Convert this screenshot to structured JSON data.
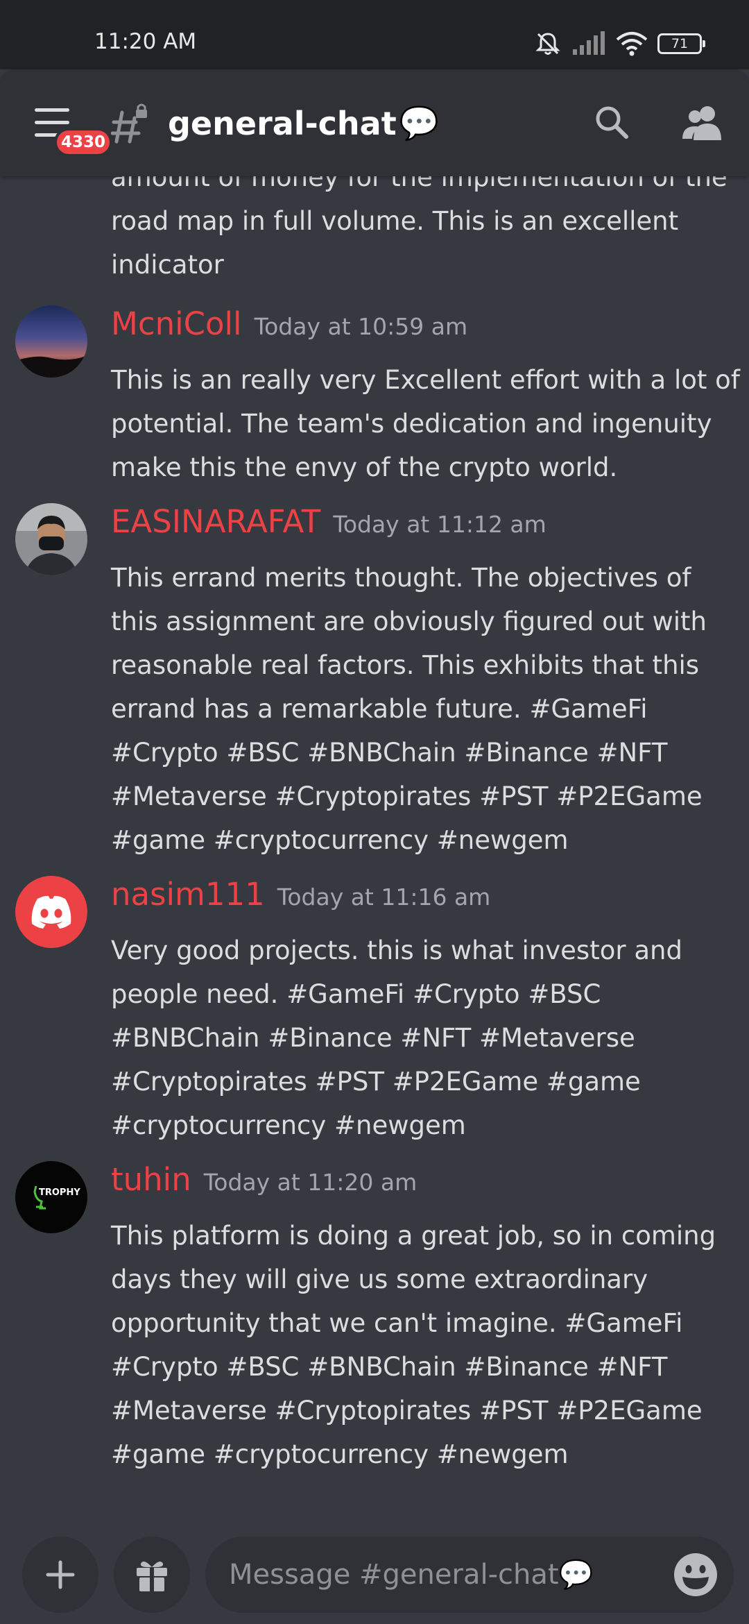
{
  "status_bar": {
    "time": "11:20 AM",
    "battery": "71"
  },
  "header": {
    "unread_badge": "4330",
    "channel_name": "general-chat",
    "channel_emoji": "💬"
  },
  "previous_message_continuation": "amount of money for the implementation of the road map in full volume. This is an excellent indicator",
  "messages": [
    {
      "username": "McniColl",
      "timestamp": "Today at 10:59 am",
      "text": "This is an really very Excellent effort with a lot of potential. The team's dedication and ingenuity make this the envy of the crypto world."
    },
    {
      "username": "EASINARAFAT",
      "timestamp": "Today at 11:12 am",
      "text": "This errand merits thought. The objectives of this assignment are obviously figured out with reasonable real factors. This exhibits that this errand has a remarkable future. #GameFi #Crypto #BSC #BNBChain #Binance #NFT #Metaverse #Cryptopirates #PST #P2EGame #game #cryptocurrency #newgem"
    },
    {
      "username": "nasim111",
      "timestamp": "Today at 11:16 am",
      "text": "Very good projects. this is what investor and people need.   #GameFi #Crypto #BSC #BNBChain #Binance   #NFT #Metaverse #Cryptopirates #PST #P2EGame #game #cryptocurrency #newgem"
    },
    {
      "username": "tuhin",
      "timestamp": "Today at 11:20 am",
      "avatar_text": "TROPHY",
      "text": "This platform is doing a great job, so in coming days they will give us some extraordinary opportunity that we can't imagine. #GameFi #Crypto #BSC #BNBChain #Binance   #NFT #Metaverse #Cryptopirates #PST #P2EGame #game #cryptocurrency #newgem"
    }
  ],
  "composer": {
    "placeholder": "Message #general-chat💬"
  },
  "colors": {
    "background": "#36393f",
    "header": "#2f3136",
    "username": "#ed4245",
    "timestamp": "#a3a6aa",
    "text": "#dcddde"
  }
}
